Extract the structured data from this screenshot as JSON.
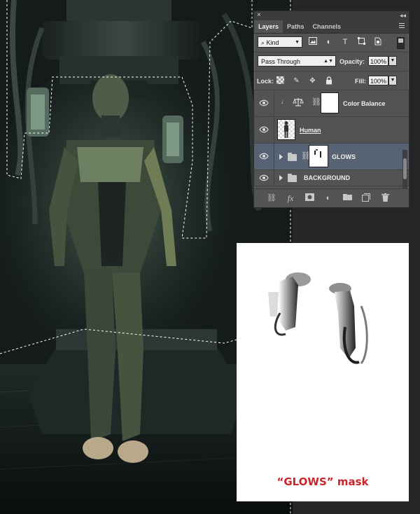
{
  "panel": {
    "close_glyph": "×",
    "collapse_glyph": "◂◂",
    "tabs": [
      {
        "label": "Layers",
        "active": true
      },
      {
        "label": "Paths",
        "active": false
      },
      {
        "label": "Channels",
        "active": false
      }
    ],
    "filter": {
      "kind_label": "Kind",
      "icons": [
        "image-filter-icon",
        "adjustment-filter-icon",
        "type-filter-icon",
        "shape-filter-icon",
        "smart-object-filter-icon"
      ]
    },
    "blend": {
      "mode": "Pass Through",
      "opacity_label": "Opacity:",
      "opacity_value": "100%"
    },
    "lock": {
      "label": "Lock:",
      "icons": [
        "lock-transparent-icon",
        "lock-image-icon",
        "lock-position-icon",
        "lock-all-icon"
      ],
      "fill_label": "Fill:",
      "fill_value": "100%"
    },
    "layers": [
      {
        "name": "Color Balance",
        "type": "adjustment",
        "visible": true
      },
      {
        "name": "Human",
        "type": "pixel",
        "visible": true
      },
      {
        "name": "GLOWS",
        "type": "group-with-mask",
        "visible": true,
        "selected": true
      },
      {
        "name": "BACKGROUND",
        "type": "group",
        "visible": true
      }
    ],
    "footer_icons": [
      "link-icon",
      "fx-icon",
      "mask-icon",
      "adjustment-icon",
      "folder-icon",
      "new-layer-icon",
      "trash-icon"
    ],
    "fx_label": "fx"
  },
  "mask_preview": {
    "caption": "“GLOWS” mask"
  },
  "colors": {
    "panel_bg": "#535353",
    "selected_layer": "#576274",
    "caption": "#c9252b"
  }
}
